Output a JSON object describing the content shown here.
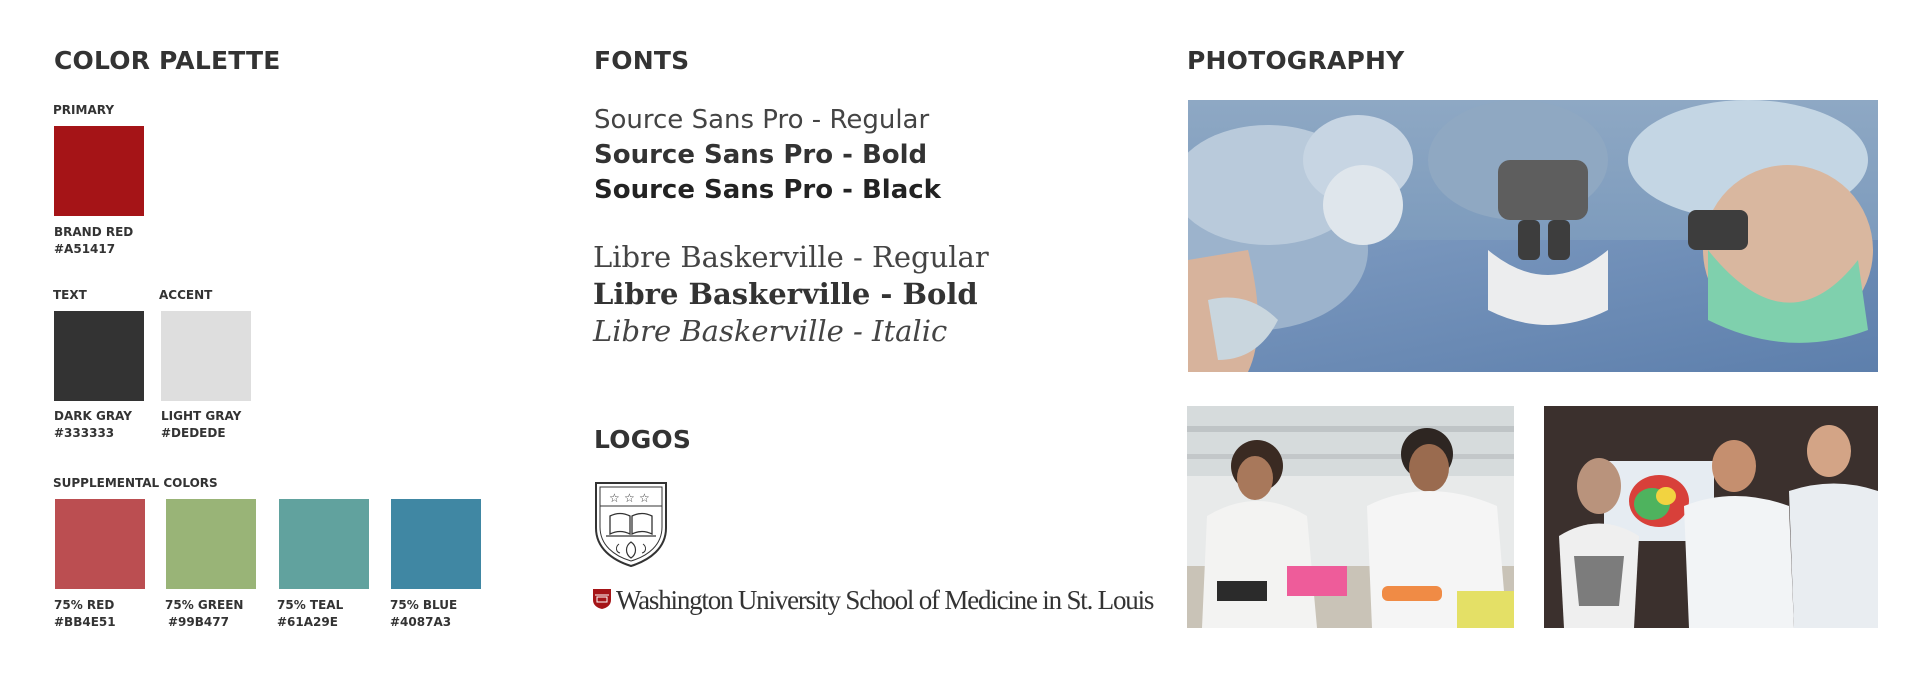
{
  "palette": {
    "heading": "COLOR PALETTE",
    "primary_label": "PRIMARY",
    "primary": {
      "name": "BRAND RED",
      "hex": "#A51417"
    },
    "text_label": "TEXT",
    "accent_label": "ACCENT",
    "text_color": {
      "name": "DARK GRAY",
      "hex": "#333333"
    },
    "accent_color": {
      "name": "LIGHT GRAY",
      "hex": "#DEDEDE"
    },
    "supplemental_label": "SUPPLEMENTAL COLORS",
    "supplemental": [
      {
        "name": "75% RED",
        "hex": "#BB4E51"
      },
      {
        "name": "75% GREEN",
        "hex": "#99B477"
      },
      {
        "name": "75% TEAL",
        "hex": "#61A29E"
      },
      {
        "name": "75% BLUE",
        "hex": "#4087A3"
      }
    ]
  },
  "fonts": {
    "heading": "FONTS",
    "sans": [
      "Source Sans Pro - Regular",
      "Source Sans Pro - Bold",
      "Source Sans Pro - Black"
    ],
    "serif": [
      "Libre Baskerville - Regular",
      "Libre Baskerville - Bold",
      "Libre Baskerville - Italic"
    ]
  },
  "logos": {
    "heading": "LOGOS",
    "wordmark": "Washington University School of Medicine in St. Louis"
  },
  "photography": {
    "heading": "PHOTOGRAPHY"
  }
}
